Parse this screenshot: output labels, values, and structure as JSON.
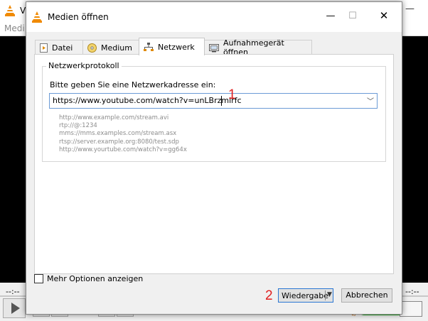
{
  "background_app": {
    "title_fragment": "V",
    "menu_fragment": "Medi",
    "time_left": "--:--",
    "time_right": "--:--"
  },
  "dialog": {
    "title": "Medien öffnen",
    "controls": {
      "minimize": "—",
      "maximize": "☐",
      "close": "✕"
    },
    "tabs": [
      {
        "label": "Datei",
        "icon": "file-play-icon"
      },
      {
        "label": "Medium",
        "icon": "disc-icon"
      },
      {
        "label": "Netzwerk",
        "icon": "network-icon",
        "active": true
      },
      {
        "label": "Aufnahmegerät öffnen",
        "icon": "capture-device-icon"
      }
    ],
    "network": {
      "group_title": "Netzwerkprotokoll",
      "prompt": "Bitte geben Sie eine Netzwerkadresse ein:",
      "url_value": "https://www.youtube.com/watch?v=unLBrzmirfc",
      "examples": [
        "http://www.example.com/stream.avi",
        "rtp://@:1234",
        "mms://mms.examples.com/stream.asx",
        "rtsp://server.example.org:8080/test.sdp",
        "http://www.yourtube.com/watch?v=gg64x"
      ]
    },
    "more_options_label": "Mehr Optionen anzeigen",
    "more_options_checked": false,
    "play_button": "Wiedergabe",
    "cancel_button": "Abbrechen"
  },
  "annotations": {
    "step1": "1",
    "step2": "2"
  },
  "colors": {
    "annotation": "#e02020",
    "focus_border": "#2a77d3",
    "vlc_orange": "#f08a00"
  }
}
